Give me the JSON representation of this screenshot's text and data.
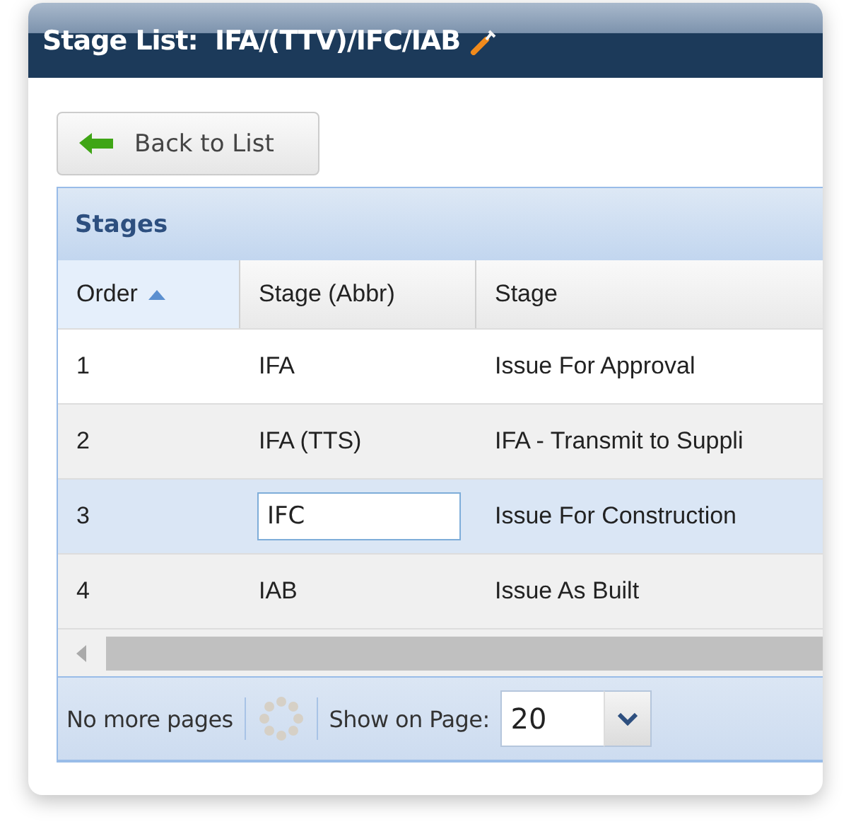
{
  "window": {
    "title": "Stage List:  IFA/(TTV)/IFC/IAB"
  },
  "back_button": {
    "label": "Back to List"
  },
  "grid": {
    "title": "Stages",
    "columns": [
      {
        "label": "Order",
        "sorted": true
      },
      {
        "label": "Stage (Abbr)",
        "sorted": false
      },
      {
        "label": "Stage",
        "sorted": false
      }
    ],
    "rows": [
      {
        "cells": [
          "1",
          "IFA",
          "Issue For Approval"
        ],
        "selected": false,
        "editing": false
      },
      {
        "cells": [
          "2",
          "IFA (TTS)",
          "IFA - Transmit to Suppli"
        ],
        "selected": false,
        "editing": false
      },
      {
        "cells": [
          "3",
          "IFC",
          "Issue For Construction"
        ],
        "selected": true,
        "editing": true
      },
      {
        "cells": [
          "4",
          "IAB",
          "Issue As Built"
        ],
        "selected": false,
        "editing": false
      }
    ]
  },
  "pager": {
    "status": "No more pages",
    "page_size_label": "Show on Page:",
    "page_size": "20"
  }
}
